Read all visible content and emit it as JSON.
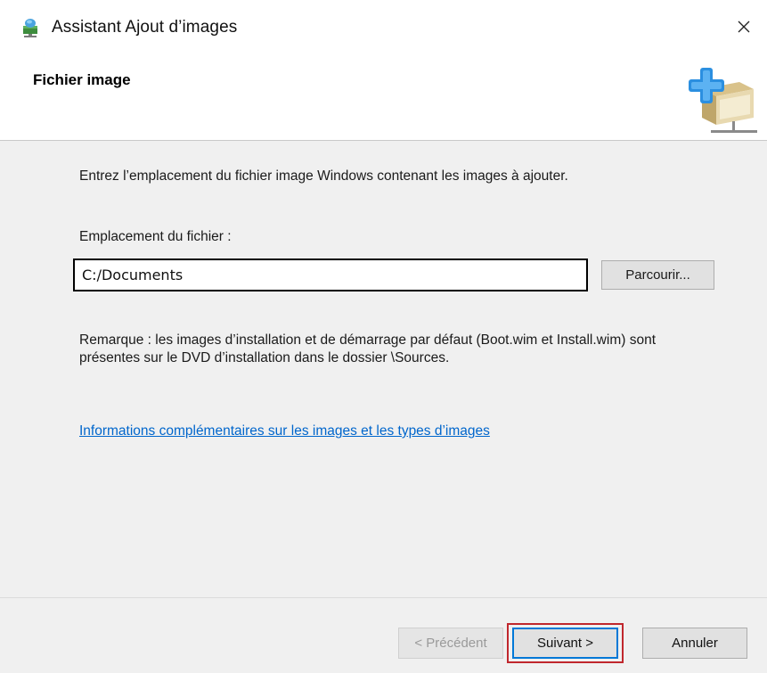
{
  "window": {
    "title": "Assistant Ajout d’images",
    "close_glyph": "✕",
    "icon": "wds-server-icon"
  },
  "header": {
    "title": "Fichier image",
    "image": "add-image-server-icon"
  },
  "main": {
    "instruction": "Entrez l’emplacement du fichier image Windows contenant les images à ajouter.",
    "location_label": "Emplacement du fichier :",
    "location_value": "C:/Documents",
    "browse_label": "Parcourir...",
    "note": "Remarque : les images d’installation et de démarrage par défaut (Boot.wim et Install.wim) sont présentes sur le DVD d’installation dans le dossier \\Sources.",
    "info_link": "Informations complémentaires sur les images et les types d’images"
  },
  "footer": {
    "prev_label": "< Précédent",
    "prev_enabled": false,
    "next_label": "Suivant >",
    "next_highlighted": true,
    "cancel_label": "Annuler"
  },
  "colors": {
    "link": "#0066cc",
    "highlight": "#c0272d",
    "focus": "#0078d7",
    "content_bg": "#f0f0f0"
  }
}
